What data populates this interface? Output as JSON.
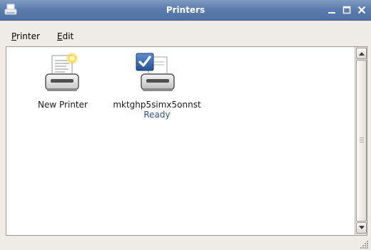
{
  "window": {
    "title": "Printers",
    "icon": "printer-icon",
    "controls": [
      "minimize-icon",
      "maximize-icon",
      "close-icon"
    ]
  },
  "menubar": {
    "items": [
      {
        "mnemonic": "P",
        "rest": "rinter"
      },
      {
        "mnemonic": "E",
        "rest": "dit"
      }
    ]
  },
  "printers": [
    {
      "name": "New Printer",
      "status": "",
      "icon": "new-printer-icon"
    },
    {
      "name": "mktghp5simx5onnst",
      "status": "Ready",
      "icon": "default-printer-icon"
    }
  ],
  "colors": {
    "titlebar": "#5d7eae",
    "status_text": "#35508c",
    "checkbox_blue": "#3a66b0"
  }
}
